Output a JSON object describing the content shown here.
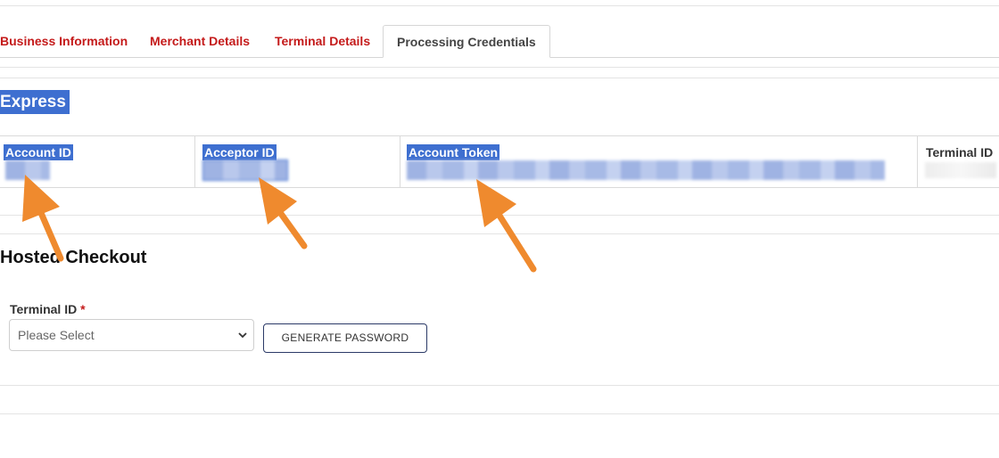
{
  "tabs": [
    {
      "label": "Business Information",
      "active": false
    },
    {
      "label": "Merchant Details",
      "active": false
    },
    {
      "label": "Terminal Details",
      "active": false
    },
    {
      "label": "Processing Credentials",
      "active": true
    }
  ],
  "express": {
    "title": "Express",
    "columns": [
      {
        "label": "Account ID",
        "value_redacted": true,
        "selected": true
      },
      {
        "label": "Acceptor ID",
        "value_redacted": true,
        "selected": true
      },
      {
        "label": "Account Token",
        "value_redacted": true,
        "selected": true
      },
      {
        "label": "Terminal ID",
        "value_redacted": true,
        "selected": false
      }
    ]
  },
  "hosted_checkout": {
    "title": "Hosted Checkout",
    "terminal_field": {
      "label": "Terminal ID",
      "required_marker": "*",
      "selected_value": "Please Select"
    },
    "generate_button": "GENERATE PASSWORD"
  },
  "annotations": {
    "arrow_color": "#ef8a2e",
    "arrow_count": 3
  },
  "colors": {
    "tab_link": "#c41a1a",
    "selection": "#3e6fd0"
  }
}
